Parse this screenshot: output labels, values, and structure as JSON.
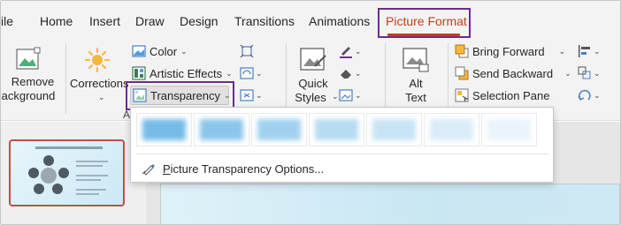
{
  "tabs": [
    {
      "label": "ile",
      "active": false
    },
    {
      "label": "Home",
      "active": false
    },
    {
      "label": "Insert",
      "active": false
    },
    {
      "label": "Draw",
      "active": false
    },
    {
      "label": "Design",
      "active": false
    },
    {
      "label": "Transitions",
      "active": false
    },
    {
      "label": "Animations",
      "active": false
    },
    {
      "label": "Picture Format",
      "active": true
    }
  ],
  "ribbon": {
    "remove_background": {
      "line1": "Remove",
      "line2": "ackground"
    },
    "corrections": {
      "label": "Corrections"
    },
    "adjust_group_label": "A",
    "color": {
      "label": "Color"
    },
    "artistic_effects": {
      "label": "Artistic Effects"
    },
    "transparency": {
      "label": "Transparency"
    },
    "quick_styles": {
      "line1": "Quick",
      "line2": "Styles"
    },
    "alt_text": {
      "line1": "Alt",
      "line2": "Text"
    },
    "bring_forward": {
      "label": "Bring Forward"
    },
    "send_backward": {
      "label": "Send Backward"
    },
    "selection_pane": {
      "label": "Selection Pane"
    }
  },
  "dropdown": {
    "options_label": "Picture Transparency Options...",
    "options_underline_char": "P",
    "options_rest": "icture Transparency Options...",
    "swatch_count": 7
  },
  "thumbnail": {
    "title": "SPIRITUAL ELEMENT DIAGRAM"
  },
  "colors": {
    "accent": "#c43e1c",
    "highlight_box": "#6b2c8f",
    "ribbon_bg": "#f3f3f3",
    "thumb_border": "#c0504d"
  }
}
